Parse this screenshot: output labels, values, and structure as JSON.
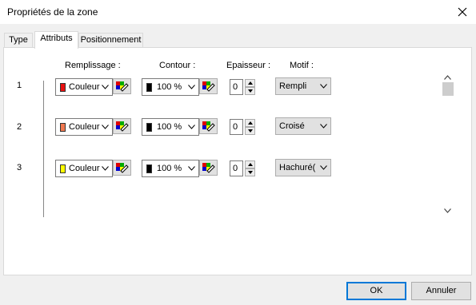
{
  "window": {
    "title": "Propriétés de la zone"
  },
  "tabs": [
    {
      "label": "Type",
      "active": false
    },
    {
      "label": "Attributs",
      "active": true
    },
    {
      "label": "Positionnement",
      "active": false
    }
  ],
  "headers": {
    "remplissage": "Remplissage :",
    "contour": "Contour :",
    "epaisseur": "Epaisseur :",
    "motif": "Motif :"
  },
  "rows": [
    {
      "number": "1",
      "fill_label": "Couleur",
      "fill_color": "#e81010",
      "outline_label": "100 %",
      "outline_color": "#000000",
      "thickness": "0",
      "motif": "Rempli"
    },
    {
      "number": "2",
      "fill_label": "Couleur",
      "fill_color": "#f07850",
      "outline_label": "100 %",
      "outline_color": "#000000",
      "thickness": "0",
      "motif": "Croisé"
    },
    {
      "number": "3",
      "fill_label": "Couleur",
      "fill_color": "#ffff00",
      "outline_label": "100 %",
      "outline_color": "#000000",
      "thickness": "0",
      "motif": "Hachuré("
    }
  ],
  "buttons": {
    "ok": "OK",
    "cancel": "Annuler"
  },
  "icons": {
    "close": "close-icon",
    "dropdown": "chevron-down-icon",
    "color_picker": "color-picker-icon",
    "spin_up": "spin-up-icon",
    "spin_down": "spin-down-icon"
  },
  "colors": {
    "accent": "#0078d7"
  }
}
